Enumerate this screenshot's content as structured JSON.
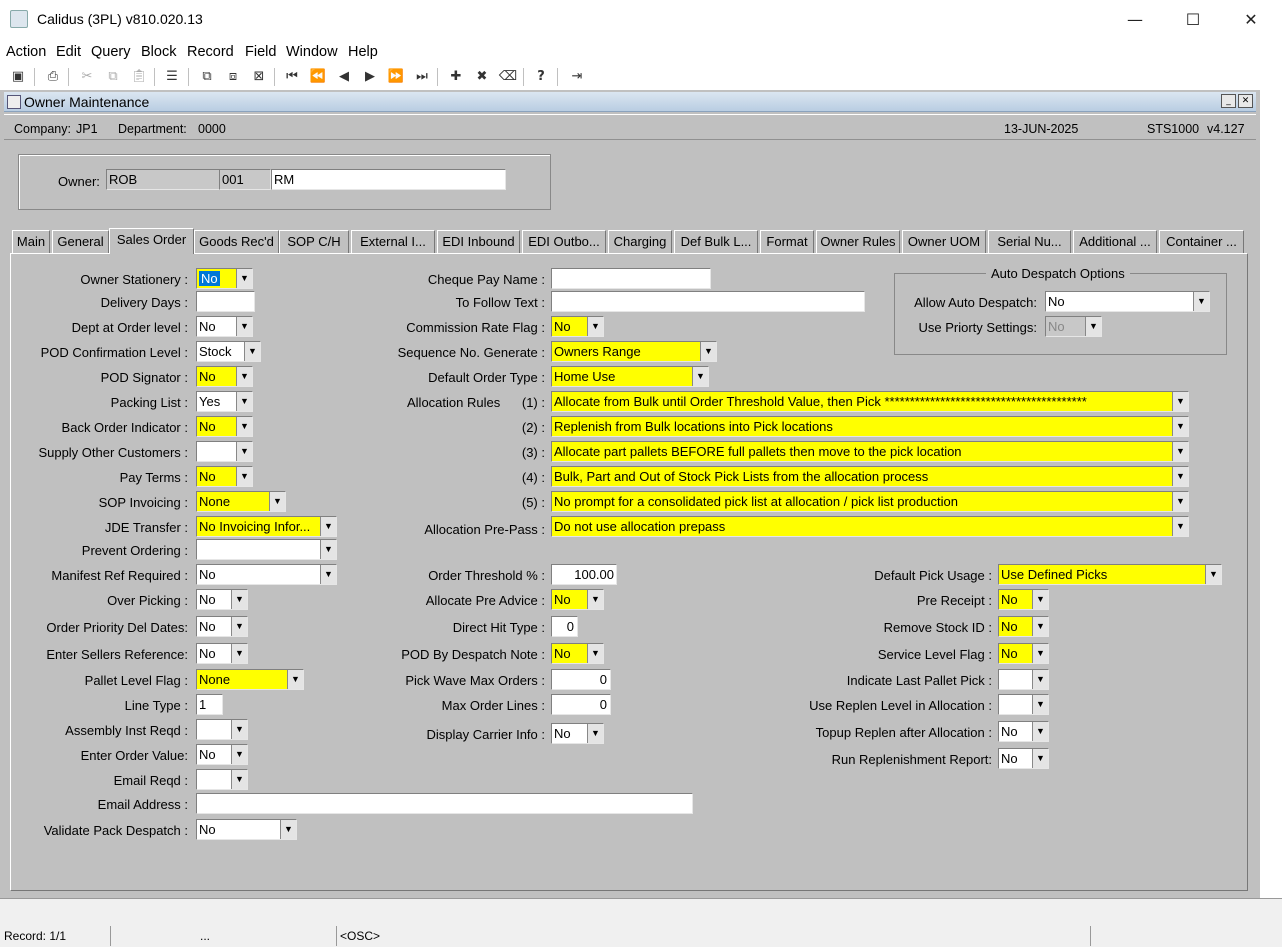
{
  "window": {
    "title": "Calidus (3PL) v810.020.13",
    "min": "—",
    "max": "☐",
    "close": "✕"
  },
  "menu": [
    "Action",
    "Edit",
    "Query",
    "Block",
    "Record",
    "Field",
    "Window",
    "Help"
  ],
  "inner": {
    "title": "Owner Maintenance",
    "min": "_",
    "close": "✕"
  },
  "info": {
    "company_label": "Company:",
    "company": "JP1",
    "dept_label": "Department:",
    "dept": "0000",
    "date": "13-JUN-2025",
    "program": "STS1000",
    "version": "v4.127"
  },
  "owner": {
    "label": "Owner:",
    "code": "ROB",
    "num": "001",
    "name": "RM"
  },
  "tabs": [
    "Main",
    "General",
    "Sales Order",
    "Goods Rec'd",
    "SOP C/H",
    "External I...",
    "EDI Inbound",
    "EDI Outbo...",
    "Charging",
    "Def Bulk L...",
    "Format",
    "Owner Rules",
    "Owner UOM",
    "Serial Nu...",
    "Additional ...",
    "Container ..."
  ],
  "left": [
    {
      "label": "Owner Stationery :",
      "value": "No"
    },
    {
      "label": "Delivery Days :",
      "value": ""
    },
    {
      "label": "Dept at Order level :",
      "value": "No"
    },
    {
      "label": "POD Confirmation Level :",
      "value": "Stock"
    },
    {
      "label": "POD Signator :",
      "value": "No"
    },
    {
      "label": "Packing List :",
      "value": "Yes"
    },
    {
      "label": "Back Order Indicator :",
      "value": "No"
    },
    {
      "label": "Supply Other Customers :",
      "value": ""
    },
    {
      "label": "Pay Terms :",
      "value": "No"
    },
    {
      "label": "SOP Invoicing :",
      "value": "None"
    },
    {
      "label": "JDE Transfer :",
      "value": "No Invoicing Infor..."
    },
    {
      "label": "Prevent Ordering :",
      "value": ""
    },
    {
      "label": "Manifest Ref Required :",
      "value": "No"
    },
    {
      "label": "Over Picking :",
      "value": "No"
    },
    {
      "label": "Order Priority Del Dates:",
      "value": "No"
    },
    {
      "label": "Enter Sellers Reference:",
      "value": "No"
    },
    {
      "label": "Pallet Level Flag :",
      "value": "None"
    },
    {
      "label": "Line Type :",
      "value": "1"
    },
    {
      "label": "Assembly Inst Reqd :",
      "value": ""
    },
    {
      "label": "Enter Order Value:",
      "value": "No"
    },
    {
      "label": "Email Reqd :",
      "value": ""
    },
    {
      "label": "Email Address :",
      "value": ""
    },
    {
      "label": "Validate Pack Despatch :",
      "value": "No"
    }
  ],
  "mid": [
    {
      "label": "Cheque Pay Name :",
      "value": ""
    },
    {
      "label": "To Follow Text :",
      "value": ""
    },
    {
      "label": "Commission Rate Flag :",
      "value": "No"
    },
    {
      "label": "Sequence No. Generate :",
      "value": "Owners Range"
    },
    {
      "label": "Default Order Type :",
      "value": "Home Use"
    }
  ],
  "alloc": {
    "label": "Allocation Rules",
    "rules": [
      {
        "n": "(1) :",
        "value": "Allocate from Bulk until Order  Threshold Value, then Pick ****************************************"
      },
      {
        "n": "(2) :",
        "value": "Replenish from Bulk locations into Pick locations"
      },
      {
        "n": "(3) :",
        "value": "Allocate part pallets BEFORE full pallets then move to the pick location"
      },
      {
        "n": "(4) :",
        "value": "Bulk, Part and Out of Stock Pick Lists from the allocation process"
      },
      {
        "n": "(5) :",
        "value": "No prompt for a consolidated pick list at allocation / pick list production"
      }
    ],
    "prepass_label": "Allocation Pre-Pass :",
    "prepass": "Do not use allocation prepass"
  },
  "mid2": [
    {
      "label": "Order Threshold %  :",
      "value": "100.00"
    },
    {
      "label": "Allocate  Pre Advice :",
      "value": "No"
    },
    {
      "label": "Direct Hit Type :",
      "value": "0"
    },
    {
      "label": "POD By Despatch Note :",
      "value": "No"
    },
    {
      "label": "Pick Wave Max Orders :",
      "value": "0"
    },
    {
      "label": "Max Order Lines :",
      "value": "0"
    },
    {
      "label": "Display Carrier Info :",
      "value": "No"
    }
  ],
  "auto": {
    "legend": "Auto Despatch Options",
    "allow_label": "Allow Auto Despatch:",
    "allow": "No",
    "prio_label": "Use Priorty Settings:",
    "prio": "No"
  },
  "right": [
    {
      "label": "Default Pick Usage :",
      "value": "Use Defined Picks"
    },
    {
      "label": "Pre Receipt :",
      "value": "No"
    },
    {
      "label": "Remove Stock ID :",
      "value": "No"
    },
    {
      "label": "Service Level Flag :",
      "value": "No"
    },
    {
      "label": "Indicate Last Pallet Pick :",
      "value": ""
    },
    {
      "label": "Use Replen Level in Allocation :",
      "value": ""
    },
    {
      "label": "Topup Replen after Allocation :",
      "value": "No"
    },
    {
      "label": "Run Replenishment Report:",
      "value": "No"
    }
  ],
  "status": {
    "record": "Record: 1/1",
    "dots": "...",
    "osc": "<OSC>"
  },
  "colors": {
    "yellow": "#ffff00",
    "grey": "#c0c0c0",
    "highlight": "#0078d7"
  }
}
